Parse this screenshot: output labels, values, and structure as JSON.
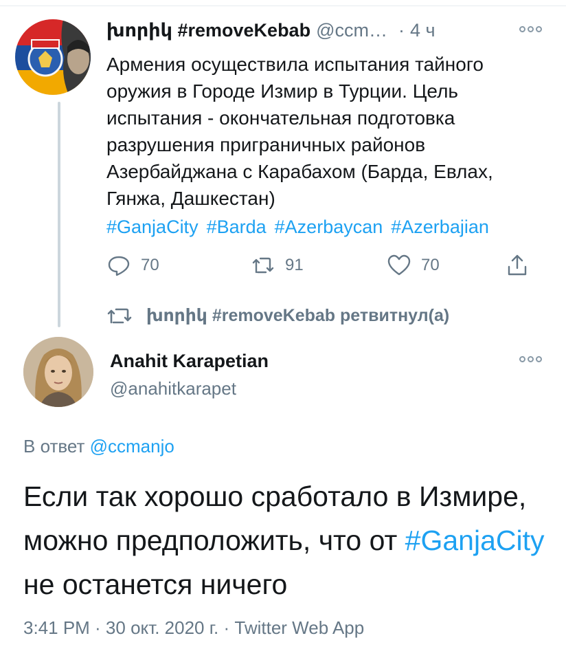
{
  "tweet1": {
    "display_name": "խորիկ #removeKebab",
    "handle": "@ccm…",
    "separator": "·",
    "time": "4 ч",
    "text": "Армения осуществила испытания тайного оружия в Городе Измир в Турции. Цель испытания - окончательная подготовка разрушения приграничных районов Азербайджана с Карабахом (Барда, Евлах, Гянжа, Дашкестан)",
    "hashtags": [
      "#GanjaCity",
      "#Barda",
      "#Azerbaycan",
      "#Azerbajian"
    ],
    "stats": {
      "replies": "70",
      "retweets": "91",
      "likes": "70"
    },
    "avatar_icon": "flag-coat-of-arms-avatar"
  },
  "retweet_context": {
    "text": "խորիկ #removeKebab ретвитнул(а)",
    "icon": "retweet-icon"
  },
  "tweet2": {
    "display_name": "Anahit Karapetian",
    "handle": "@anahitkarapet",
    "reply_prefix": "В ответ",
    "reply_mention": "@ccmanjo",
    "text_before_tag": "Если так хорошо сработало в Измире, можно предположить, что от ",
    "hashtag": "#GanjaCity",
    "text_after_tag": " не останется ничего",
    "meta": "3:41 PM · 30 окт. 2020 г. · Twitter Web App",
    "avatar_icon": "portrait-avatar"
  },
  "colors": {
    "link": "#1da1f2",
    "secondary_text": "#657786",
    "primary_text": "#14171a",
    "thread_line": "#ccd6dd"
  }
}
